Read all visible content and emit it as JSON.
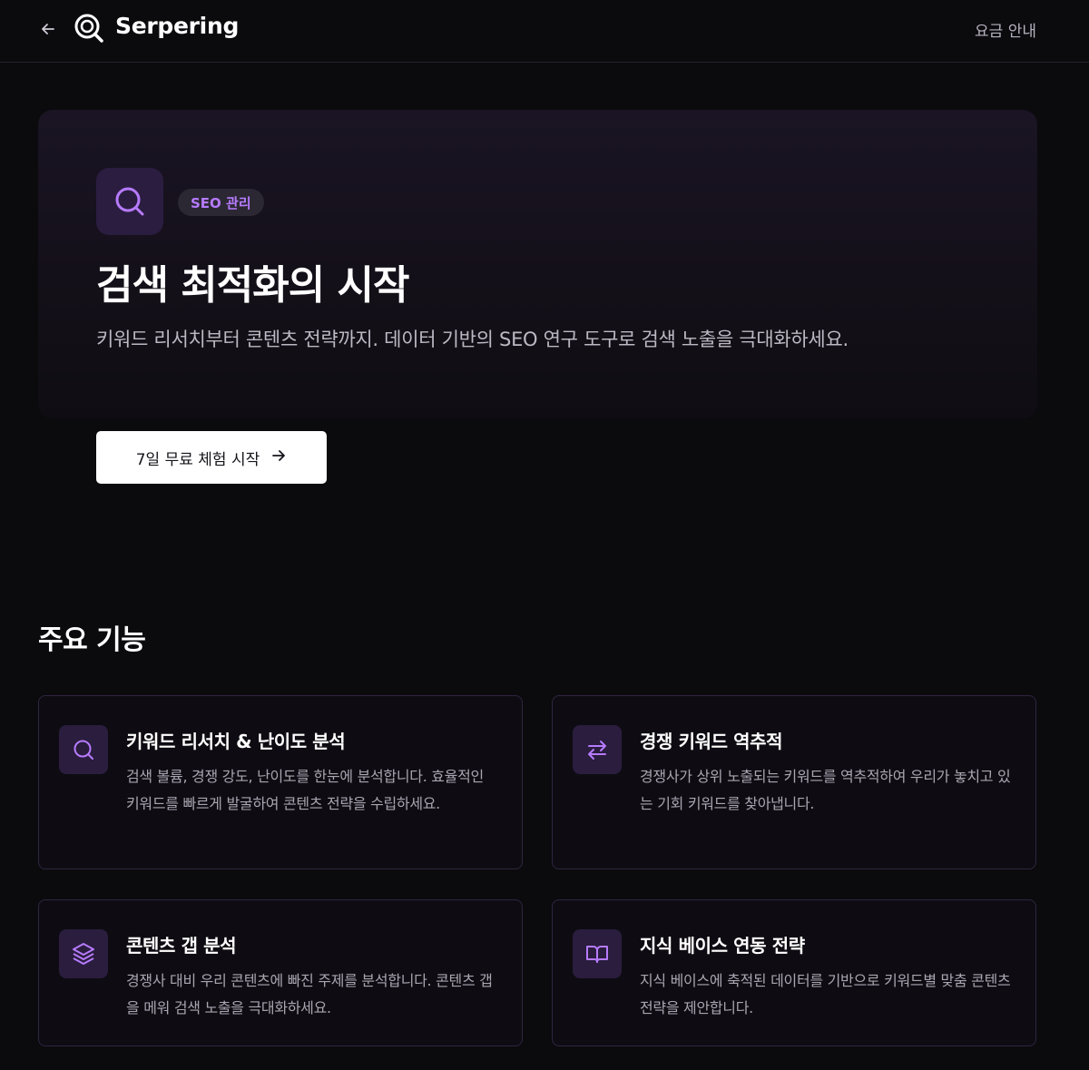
{
  "header": {
    "brand": "Serpering",
    "pricing_label": "요금 안내"
  },
  "hero": {
    "badge": "SEO 관리",
    "title": "검색 최적화의 시작",
    "description": "키워드 리서치부터 콘텐츠 전략까지. 데이터 기반의 SEO 연구 도구로 검색 노출을 극대화하세요.",
    "cta_label": "7일 무료 체험 시작"
  },
  "features": {
    "section_title": "주요 기능",
    "items": [
      {
        "icon": "search-icon",
        "title": "키워드 리서치 & 난이도 분석",
        "description": "검색 볼륨, 경쟁 강도, 난이도를 한눈에 분석합니다. 효율적인 키워드를 빠르게 발굴하여 콘텐츠 전략을 수립하세요."
      },
      {
        "icon": "swap-arrows-icon",
        "title": "경쟁 키워드 역추적",
        "description": "경쟁사가 상위 노출되는 키워드를 역추적하여 우리가 놓치고 있는 기회 키워드를 찾아냅니다."
      },
      {
        "icon": "layers-icon",
        "title": "콘텐츠 갭 분석",
        "description": "경쟁사 대비 우리 콘텐츠에 빠진 주제를 분석합니다. 콘텐츠 갭을 메워 검색 노출을 극대화하세요."
      },
      {
        "icon": "book-open-icon",
        "title": "지식 베이스 연동 전략",
        "description": "지식 베이스에 축적된 데이터를 기반으로 키워드별 맞춤 콘텐츠 전략을 제안합니다."
      }
    ]
  },
  "colors": {
    "background": "#0b0a0d",
    "accent": "#b77bff",
    "icon_bg": "#2a1d3e"
  }
}
